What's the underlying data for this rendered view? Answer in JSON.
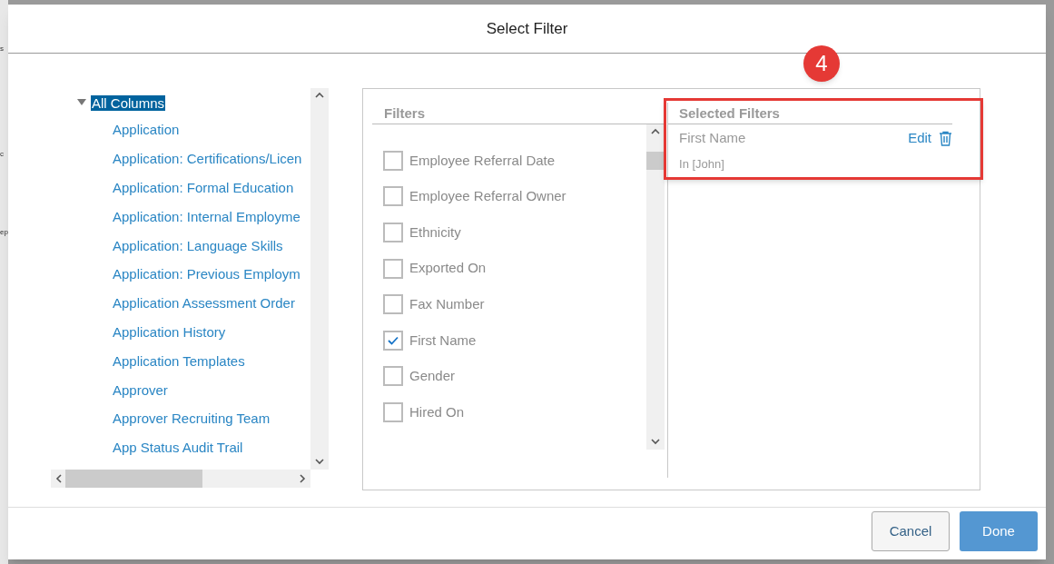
{
  "backdrop_fragments": [
    "s",
    "c",
    "ep"
  ],
  "dialog": {
    "title": "Select Filter"
  },
  "badge": "4",
  "tree": {
    "label": "All Columns",
    "expanded": true,
    "selected": true,
    "children": [
      {
        "label": "Application",
        "selected": false
      },
      {
        "label": "Application: Certifications/Licen",
        "selected": false
      },
      {
        "label": "Application: Formal Education",
        "selected": false
      },
      {
        "label": "Application: Internal Employme",
        "selected": false
      },
      {
        "label": "Application: Language Skills",
        "selected": false
      },
      {
        "label": "Application: Previous Employm",
        "selected": false
      },
      {
        "label": "Application Assessment Order",
        "selected": false
      },
      {
        "label": "Application History",
        "selected": false
      },
      {
        "label": "Application Templates",
        "selected": false
      },
      {
        "label": "Approver",
        "selected": false
      },
      {
        "label": "Approver Recruiting Team",
        "selected": false
      },
      {
        "label": "App Status Audit Trail",
        "selected": false
      }
    ]
  },
  "filters": {
    "heading": "Filters",
    "items": [
      {
        "label": "Employee Referral Date",
        "checked": false
      },
      {
        "label": "Employee Referral Owner",
        "checked": false
      },
      {
        "label": "Ethnicity",
        "checked": false
      },
      {
        "label": "Exported On",
        "checked": false
      },
      {
        "label": "Fax Number",
        "checked": false
      },
      {
        "label": "First Name",
        "checked": true
      },
      {
        "label": "Gender",
        "checked": false
      },
      {
        "label": "Hired On",
        "checked": false
      }
    ]
  },
  "selected_filters": {
    "heading": "Selected Filters",
    "items": [
      {
        "name": "First Name",
        "edit": "Edit",
        "condition": "In [John]"
      }
    ]
  },
  "buttons": [
    {
      "label": "Cancel",
      "kind": "secondary"
    },
    {
      "label": "Done",
      "kind": "primary"
    }
  ]
}
